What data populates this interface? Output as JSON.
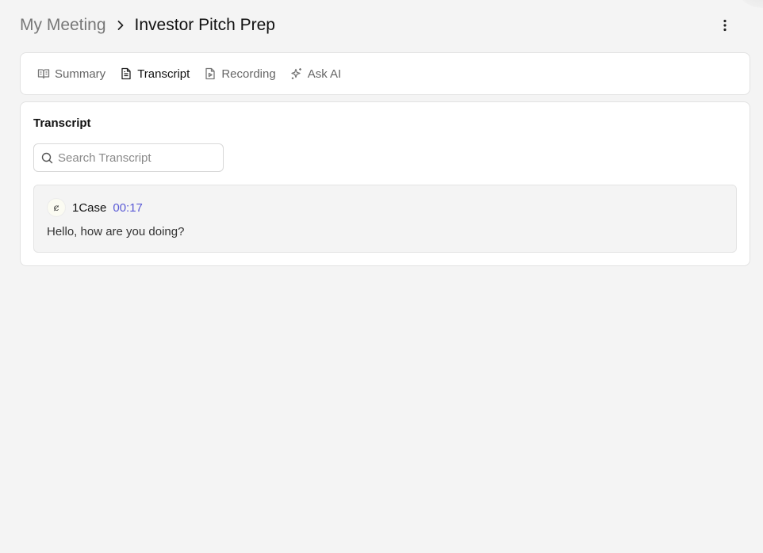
{
  "breadcrumb": {
    "parent": "My Meeting",
    "current": "Investor Pitch Prep"
  },
  "tabs": [
    {
      "label": "Summary",
      "icon": "book-open-icon",
      "active": false
    },
    {
      "label": "Transcript",
      "icon": "file-text-icon",
      "active": true
    },
    {
      "label": "Recording",
      "icon": "file-play-icon",
      "active": false
    },
    {
      "label": "Ask AI",
      "icon": "sparkles-icon",
      "active": false
    }
  ],
  "transcript": {
    "title": "Transcript",
    "search": {
      "placeholder": "Search Transcript",
      "value": ""
    },
    "entries": [
      {
        "avatar_glyph": "ȼ",
        "speaker": "1Case",
        "timestamp": "00:17",
        "text": "Hello, how are you doing?"
      }
    ]
  },
  "colors": {
    "background": "#f4f4f4",
    "card": "#ffffff",
    "timestamp": "#5b5bd6"
  }
}
